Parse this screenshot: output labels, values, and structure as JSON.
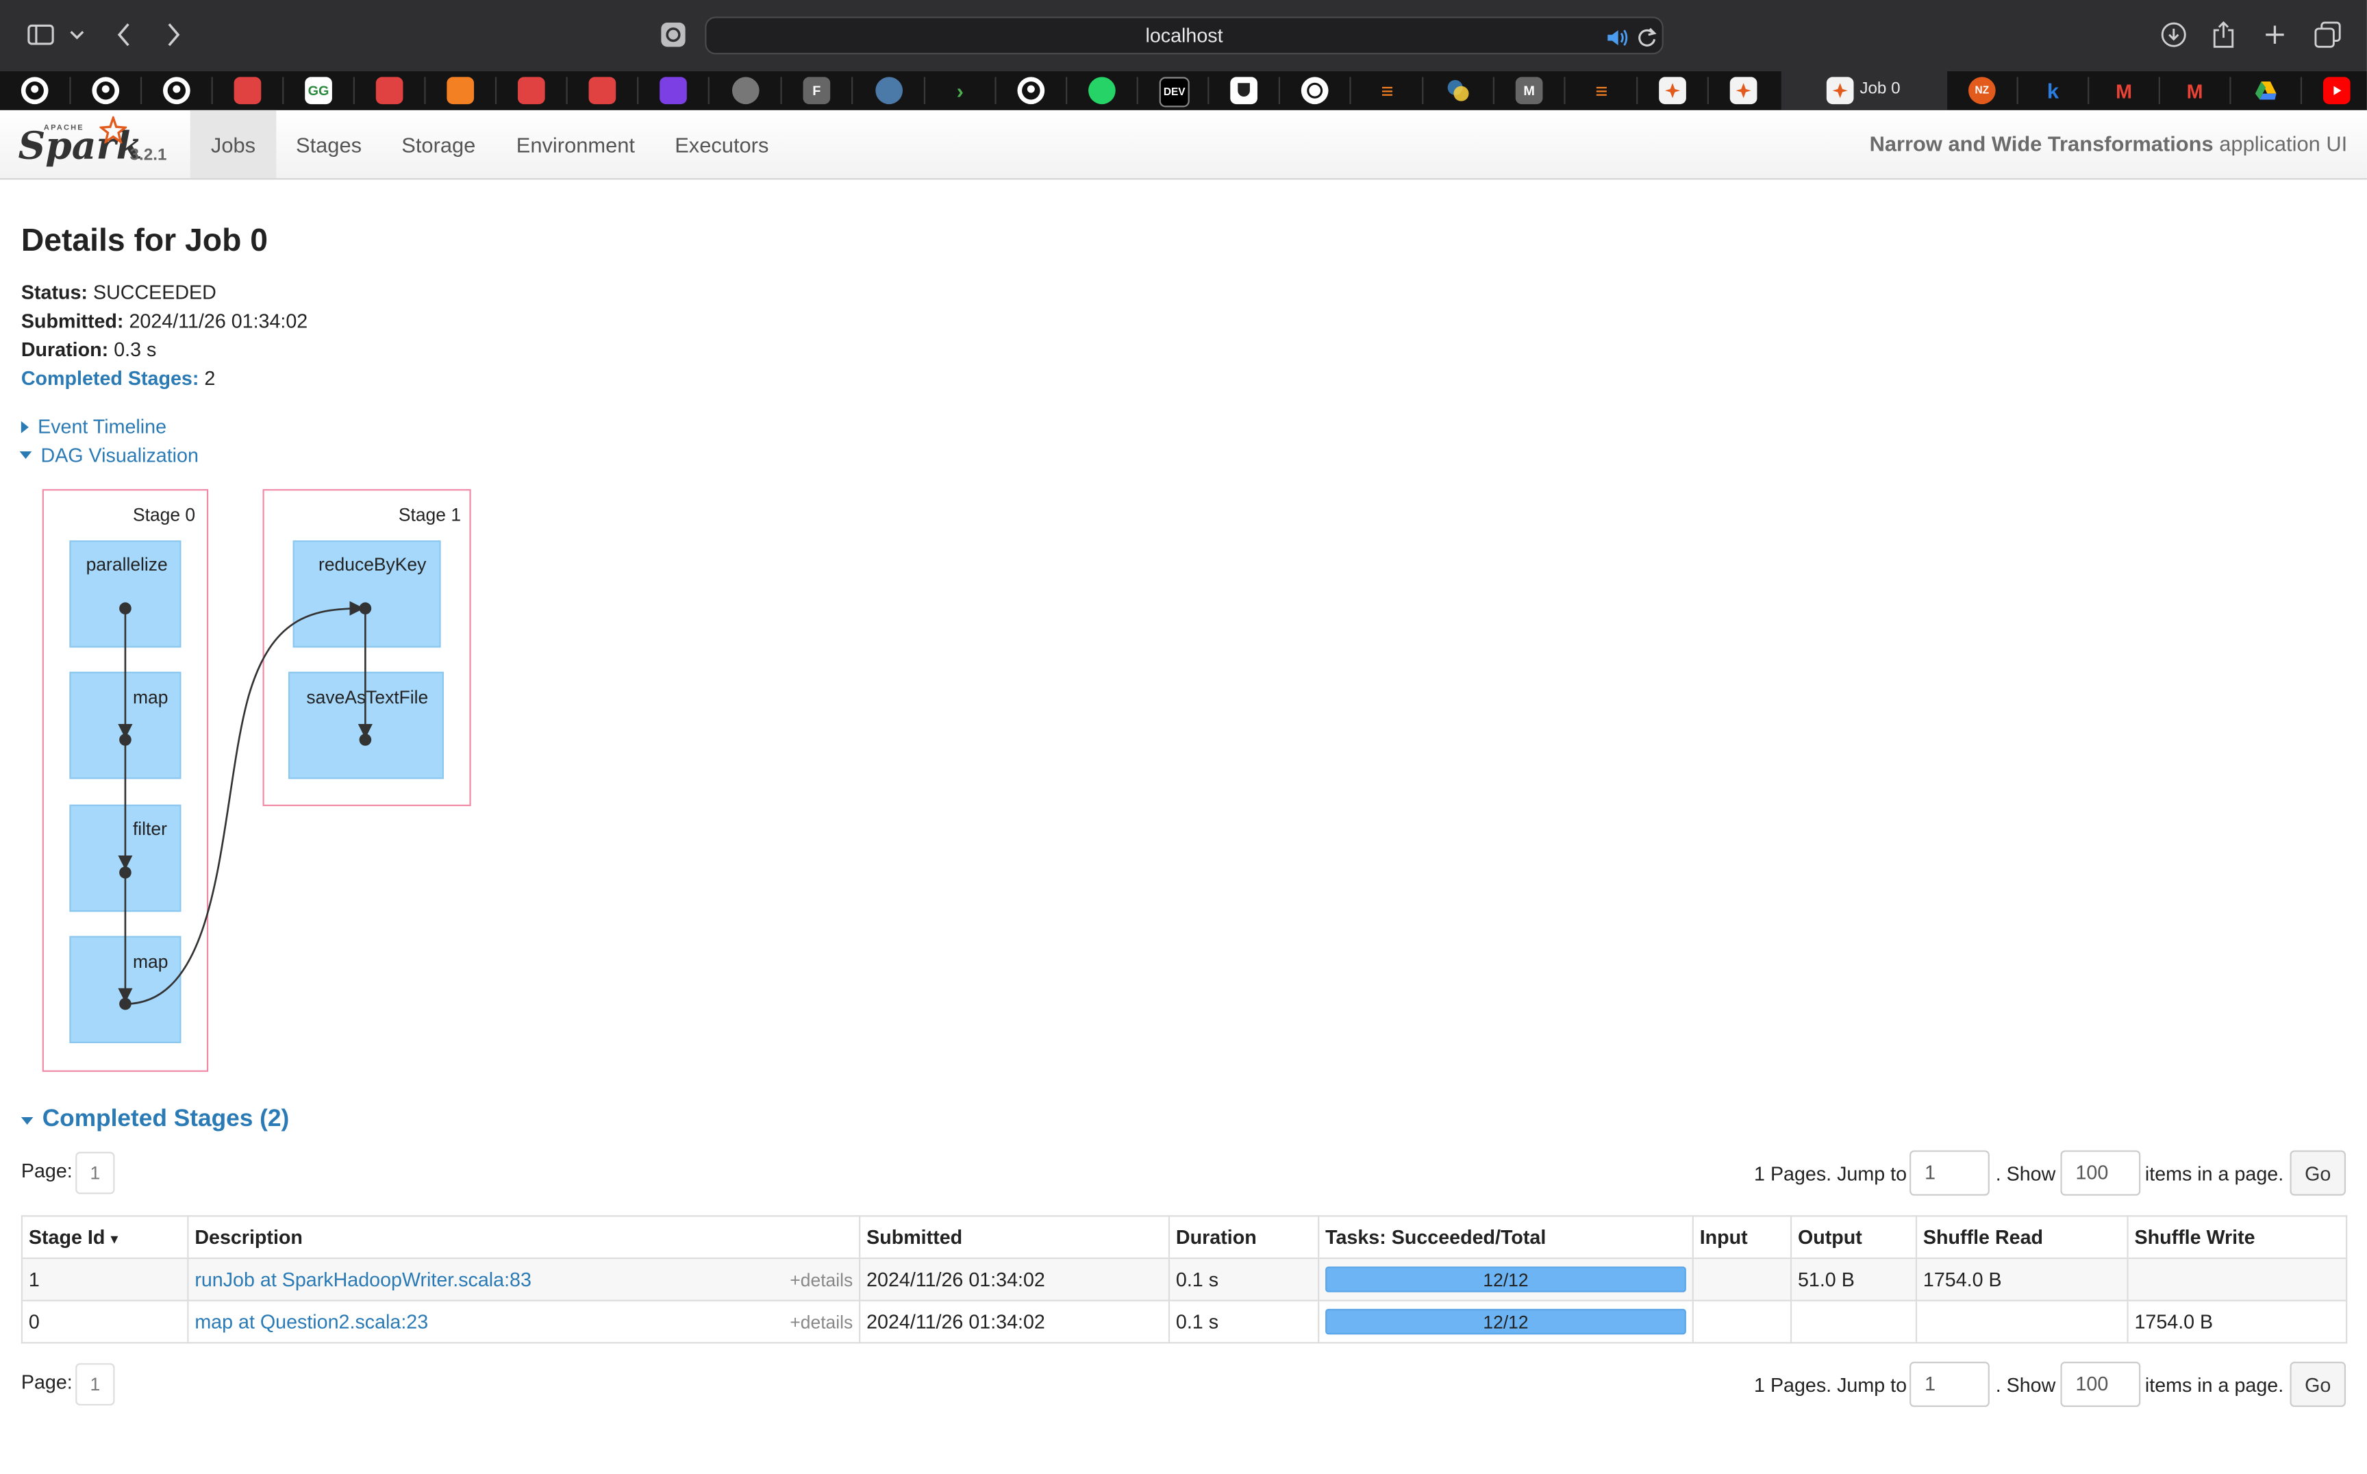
{
  "browser": {
    "url": "localhost",
    "active_tab_title": "Job 0",
    "favicons": [
      "github-icon",
      "github-icon",
      "github-icon",
      "red-book-icon",
      "geeks-icon",
      "red-book-icon",
      "stack-icon",
      "red-book-icon",
      "red-book-icon",
      "feather-icon",
      "circle-icon",
      "f-icon",
      "globe-icon",
      "chevron-icon",
      "github-icon",
      "whatsapp-icon",
      "dev-icon",
      "shield-icon",
      "openai-icon",
      "stack-icon",
      "python-icon",
      "m-icon",
      "stack-icon",
      "spark-icon",
      "spark-icon"
    ],
    "right_favicons": [
      "nz-icon",
      "k-icon",
      "gmail-icon",
      "gmail-icon",
      "drive-icon",
      "youtube-icon"
    ],
    "badge_dev": "DEV",
    "badge_f": "F",
    "badge_m": "M",
    "badge_nz": "NZ",
    "badge_k": "k",
    "badge_gmail": "M"
  },
  "spark": {
    "version": "3.2.1",
    "logo_small": "APACHE",
    "logo": "Spark",
    "nav": [
      "Jobs",
      "Stages",
      "Storage",
      "Environment",
      "Executors"
    ],
    "app_name_bold": "Narrow and Wide Transformations",
    "app_name_suffix": " application UI"
  },
  "job": {
    "title": "Details for Job 0",
    "status_label": "Status:",
    "status": "SUCCEEDED",
    "submitted_label": "Submitted:",
    "submitted": "2024/11/26 01:34:02",
    "duration_label": "Duration:",
    "duration": "0.3 s",
    "completed_label": "Completed Stages:",
    "completed": "2",
    "event_timeline": "Event Timeline",
    "dag_visualization": "DAG Visualization"
  },
  "dag": {
    "stage0_label": "Stage 0",
    "stage1_label": "Stage 1",
    "stage0_nodes": [
      "parallelize",
      "map",
      "filter",
      "map"
    ],
    "stage1_nodes": [
      "reduceByKey",
      "saveAsTextFile"
    ]
  },
  "completed_stages": {
    "header": "Completed Stages (2)",
    "page_label": "Page:",
    "page_current": "1",
    "pages_text": "1 Pages. Jump to",
    "jump_value": "1",
    "show_text": ". Show",
    "show_value": "100",
    "items_text": "items in a page.",
    "go": "Go",
    "columns": [
      "Stage Id",
      "Description",
      "Submitted",
      "Duration",
      "Tasks: Succeeded/Total",
      "Input",
      "Output",
      "Shuffle Read",
      "Shuffle Write"
    ],
    "sort_indicator": "▾",
    "details_label": "+details",
    "rows": [
      {
        "id": "1",
        "description": "runJob at SparkHadoopWriter.scala:83",
        "submitted": "2024/11/26 01:34:02",
        "duration": "0.1 s",
        "tasks": "12/12",
        "tasks_fraction": 1.0,
        "input": "",
        "output": "51.0 B",
        "shuffle_read": "1754.0 B",
        "shuffle_write": ""
      },
      {
        "id": "0",
        "description": "map at Question2.scala:23",
        "submitted": "2024/11/26 01:34:02",
        "duration": "0.1 s",
        "tasks": "12/12",
        "tasks_fraction": 1.0,
        "input": "",
        "output": "",
        "shuffle_read": "",
        "shuffle_write": "1754.0 B"
      }
    ]
  }
}
